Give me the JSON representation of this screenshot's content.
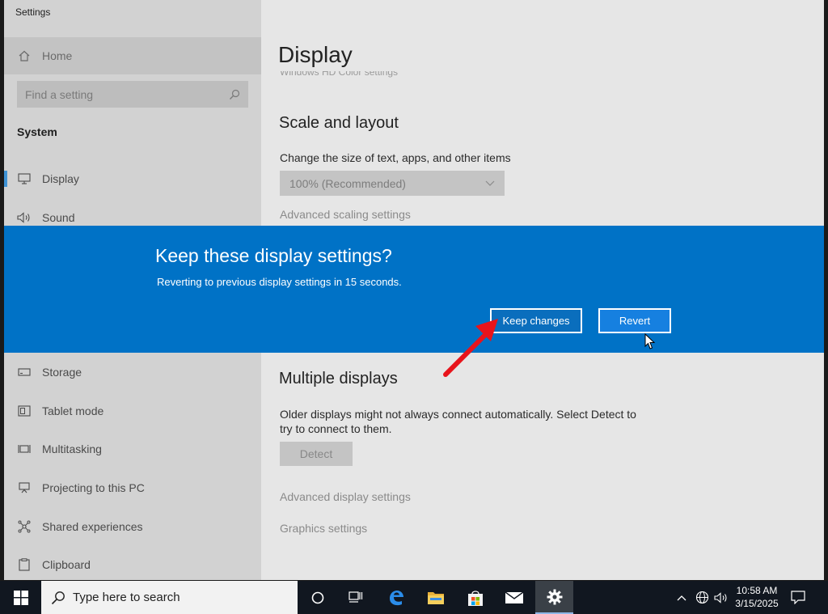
{
  "window": {
    "title": "Settings",
    "controls": [
      "minimize",
      "maximize",
      "close"
    ]
  },
  "sidebar": {
    "home_label": "Home",
    "search_placeholder": "Find a setting",
    "section": "System",
    "items": [
      {
        "label": "Display",
        "icon": "monitor-icon",
        "active": true
      },
      {
        "label": "Sound",
        "icon": "speaker-icon"
      },
      {
        "label": "Storage",
        "icon": "storage-icon"
      },
      {
        "label": "Tablet mode",
        "icon": "tablet-mode-icon"
      },
      {
        "label": "Multitasking",
        "icon": "multitasking-icon"
      },
      {
        "label": "Projecting to this PC",
        "icon": "projecting-icon"
      },
      {
        "label": "Shared experiences",
        "icon": "shared-experiences-icon"
      },
      {
        "label": "Clipboard",
        "icon": "clipboard-icon"
      }
    ]
  },
  "main": {
    "page_title": "Display",
    "faded_text": "Windows HD Color settings",
    "scale_heading": "Scale and layout",
    "scale_label": "Change the size of text, apps, and other items",
    "scale_value": "100% (Recommended)",
    "advanced_scaling": "Advanced scaling settings",
    "multiple_heading": "Multiple displays",
    "multiple_desc_1": "Older displays might not always connect automatically. Select Detect to",
    "multiple_desc_2": "try to connect to them.",
    "detect_label": "Detect",
    "advanced_display": "Advanced display settings",
    "graphics_settings": "Graphics settings"
  },
  "dialog": {
    "title": "Keep these display settings?",
    "message": "Reverting to previous display settings in 15 seconds.",
    "keep_label": "Keep changes",
    "revert_label": "Revert",
    "color": "#0072c6"
  },
  "taskbar": {
    "search_placeholder": "Type here to search",
    "time": "10:58 AM",
    "date": "3/15/2025"
  },
  "colors": {
    "accent": "#0078d7",
    "annotation_arrow": "#e8141b"
  }
}
